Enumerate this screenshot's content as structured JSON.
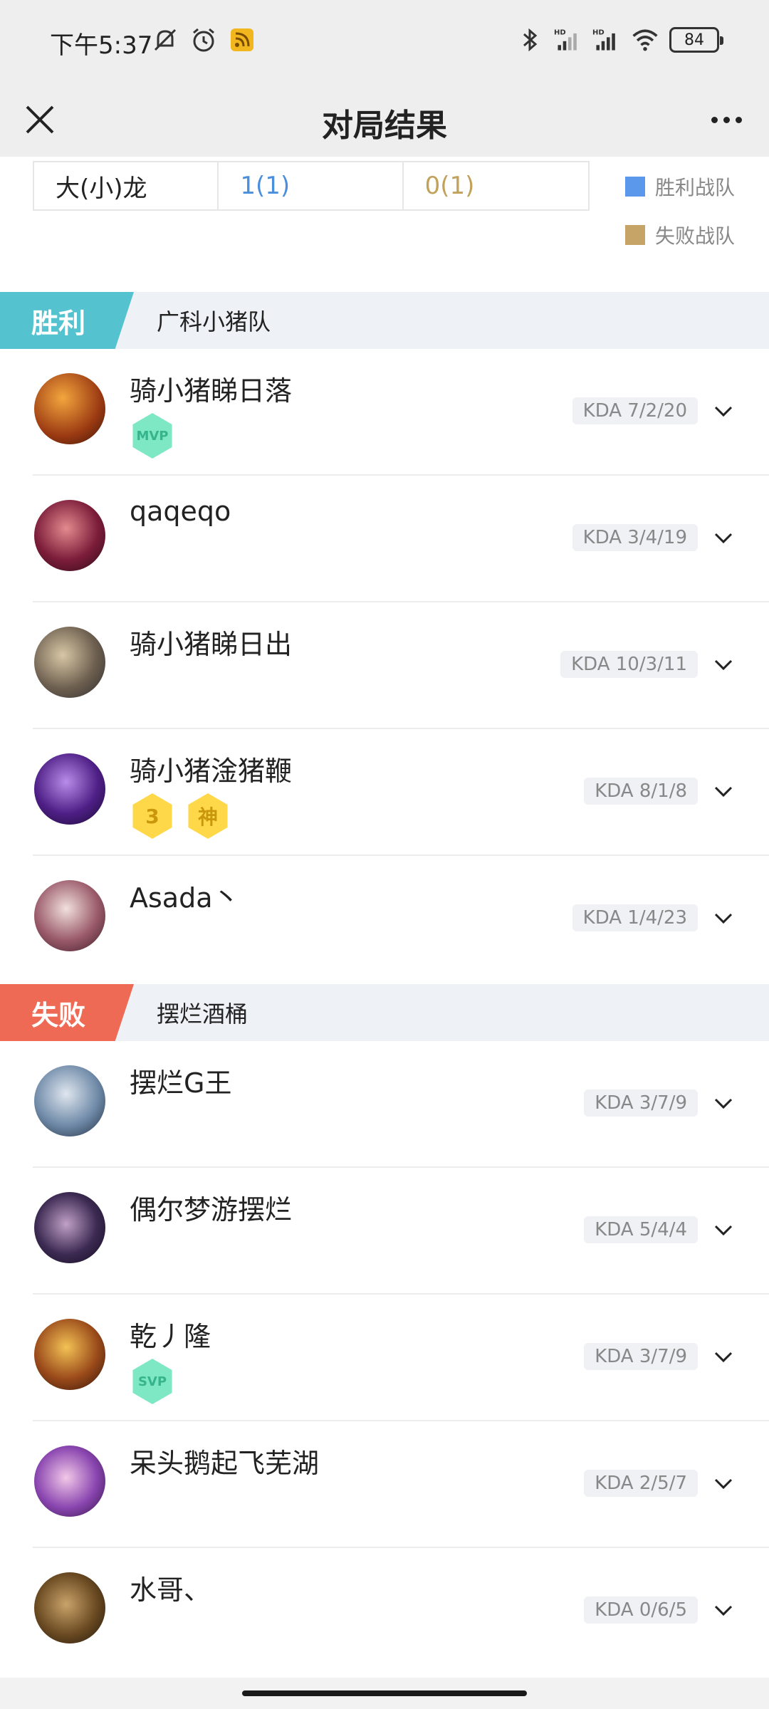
{
  "status_bar": {
    "time": "下午5:37",
    "battery": "84",
    "icons": [
      "mute-icon",
      "alarm-icon",
      "rss-icon",
      "bluetooth-icon",
      "signal-hd-icon",
      "signal-hd-icon",
      "wifi-icon",
      "battery-icon"
    ]
  },
  "nav": {
    "title": "对局结果"
  },
  "objective": {
    "name": "大(小)龙",
    "win_value": "1(1)",
    "lose_value": "0(1)"
  },
  "legend": {
    "win_label": "胜利战队",
    "lose_label": "失败战队",
    "win_color": "#5b97ea",
    "lose_color": "#c6a468"
  },
  "teams": [
    {
      "result": "胜利",
      "name": "广科小猪队",
      "tag_color": "#55c3cf",
      "players": [
        {
          "name": "骑小猪睇日落",
          "kda": "KDA 7/2/20",
          "badges": [
            "MVP"
          ]
        },
        {
          "name": "qaqeqo",
          "kda": "KDA 3/4/19",
          "badges": []
        },
        {
          "name": "骑小猪睇日出",
          "kda": "KDA 10/3/11",
          "badges": []
        },
        {
          "name": "骑小猪淦猪鞭",
          "kda": "KDA 8/1/8",
          "badges": [
            "3",
            "神"
          ]
        },
        {
          "name": "Asada丶",
          "kda": "KDA 1/4/23",
          "badges": []
        }
      ]
    },
    {
      "result": "失败",
      "name": "摆烂酒桶",
      "tag_color": "#ef6a55",
      "players": [
        {
          "name": "摆烂G王",
          "kda": "KDA 3/7/9",
          "badges": []
        },
        {
          "name": "偶尔梦游摆烂",
          "kda": "KDA 5/4/4",
          "badges": []
        },
        {
          "name": "乾丿隆",
          "kda": "KDA 3/7/9",
          "badges": [
            "SVP"
          ]
        },
        {
          "name": "呆头鹅起飞芜湖",
          "kda": "KDA 2/5/7",
          "badges": []
        },
        {
          "name": "水哥、",
          "kda": "KDA 0/6/5",
          "badges": []
        }
      ]
    }
  ]
}
